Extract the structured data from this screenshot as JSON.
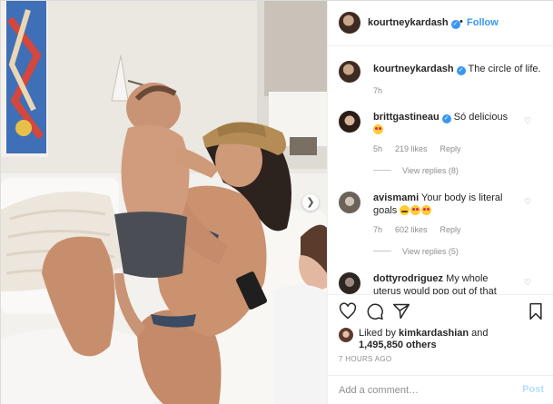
{
  "post": {
    "author": "kourtneykardash",
    "follow_label": "Follow",
    "dot": "•",
    "caption": "The circle of life.",
    "caption_time": "7h"
  },
  "comments": [
    {
      "username": "brittgastineau",
      "verified": true,
      "text": "Só delicious",
      "emoji": [
        "love"
      ],
      "time": "5h",
      "likes": "219 likes",
      "reply_label": "Reply",
      "view_replies": "View replies (8)"
    },
    {
      "username": "avismami",
      "verified": false,
      "text": "Your body is literal goals",
      "emoji": [
        "tears",
        "love",
        "love"
      ],
      "time": "7h",
      "likes": "602 likes",
      "reply_label": "Reply",
      "view_replies": "View replies (5)"
    },
    {
      "username": "dottyrodriguez",
      "verified": false,
      "text": "My whole uterus would pop out of that bathing",
      "emoji": []
    }
  ],
  "liked_by": {
    "prefix": "Liked by",
    "user": "kimkardashian",
    "and": "and",
    "count": "1,495,850 others"
  },
  "timestamp": "7 HOURS AGO",
  "add_comment": {
    "placeholder": "Add a comment…",
    "post_label": "Post"
  },
  "icons": {
    "like": "heart-icon",
    "comment": "comment-icon",
    "share": "share-icon",
    "save": "bookmark-icon",
    "more": "more-icon",
    "carousel_next": "chevron-right-icon"
  },
  "colors": {
    "accent": "#3897f0",
    "muted": "#8e8e8e",
    "text": "#262626",
    "border": "#efefef",
    "post_disabled": "#b2dffc"
  }
}
